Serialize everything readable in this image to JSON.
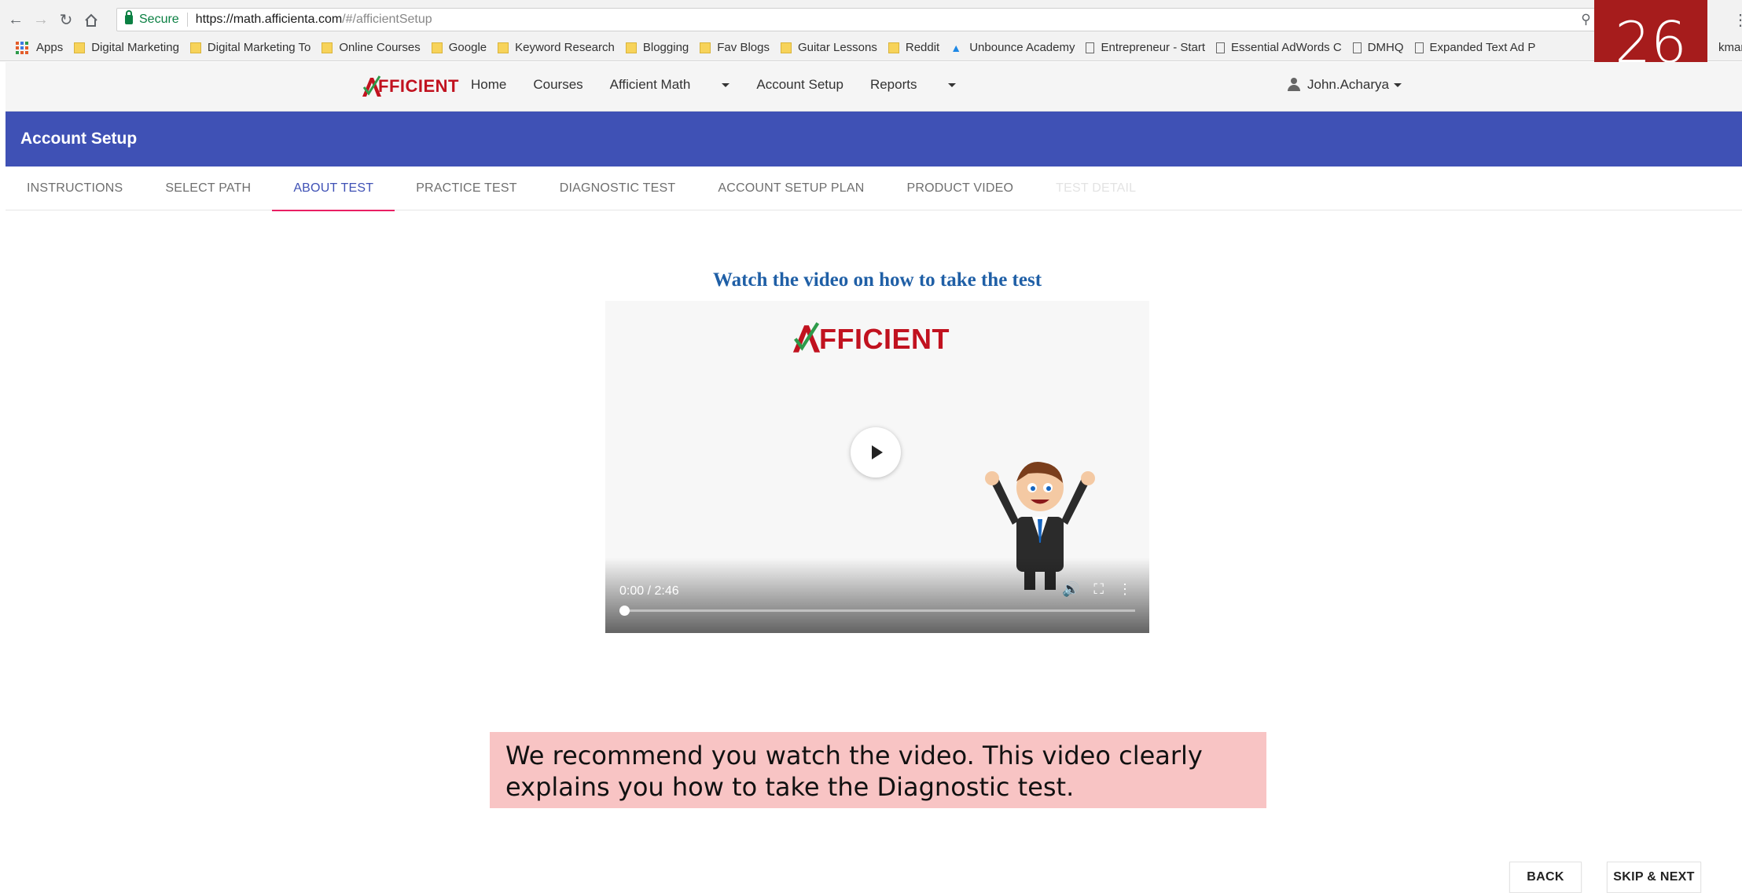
{
  "browser": {
    "secure_label": "Secure",
    "url_host": "https://math.afficienta.com",
    "url_path": "/#/afficientSetup"
  },
  "bookmarks": [
    {
      "label": "Apps",
      "icon": "apps-grid-icon"
    },
    {
      "label": "Digital Marketing",
      "icon": "folder-icon"
    },
    {
      "label": "Digital Marketing To",
      "icon": "folder-icon"
    },
    {
      "label": "Online Courses",
      "icon": "folder-icon"
    },
    {
      "label": "Google",
      "icon": "folder-icon"
    },
    {
      "label": "Keyword Research",
      "icon": "folder-icon"
    },
    {
      "label": "Blogging",
      "icon": "folder-icon"
    },
    {
      "label": "Fav Blogs",
      "icon": "folder-icon"
    },
    {
      "label": "Guitar Lessons",
      "icon": "folder-icon"
    },
    {
      "label": "Reddit",
      "icon": "folder-icon"
    },
    {
      "label": "Unbounce Academy",
      "icon": "graduation-cap-icon"
    },
    {
      "label": "Entrepreneur - Start",
      "icon": "page-icon"
    },
    {
      "label": "Essential AdWords C",
      "icon": "page-icon"
    },
    {
      "label": "DMHQ",
      "icon": "page-icon"
    },
    {
      "label": "Expanded Text Ad P",
      "icon": "page-icon"
    },
    {
      "label": "kmarks",
      "icon": "page-icon"
    }
  ],
  "slide_number": "26",
  "app": {
    "logo_text": "FFICIENT",
    "nav": {
      "home": "Home",
      "courses": "Courses",
      "afficient_math": "Afficient Math",
      "account_setup": "Account Setup",
      "reports": "Reports"
    },
    "user": "John.Acharya"
  },
  "page": {
    "title": "Account Setup",
    "tabs": [
      {
        "label": "INSTRUCTIONS",
        "state": "normal"
      },
      {
        "label": "SELECT PATH",
        "state": "normal"
      },
      {
        "label": "ABOUT TEST",
        "state": "active"
      },
      {
        "label": "PRACTICE TEST",
        "state": "normal"
      },
      {
        "label": "DIAGNOSTIC TEST",
        "state": "normal"
      },
      {
        "label": "ACCOUNT SETUP PLAN",
        "state": "normal"
      },
      {
        "label": "PRODUCT VIDEO",
        "state": "normal"
      },
      {
        "label": "TEST DETAIL",
        "state": "disabled"
      }
    ],
    "heading": "Watch the video on how to take the test",
    "video": {
      "logo_text": "FFICIENT",
      "time": "0:00 / 2:46",
      "progress": 0
    },
    "note": "We recommend you watch the video. This video clearly explains you how to take the Diagnostic test.",
    "back_label": "BACK",
    "skip_label": "SKIP & NEXT"
  },
  "colors": {
    "accent": "#3f51b5",
    "tab_indicator": "#e91e63",
    "brand_red": "#c1121f",
    "slide_badge": "#a61c1c",
    "note_bg": "#f8c4c4",
    "heading": "#1f5fa6"
  }
}
